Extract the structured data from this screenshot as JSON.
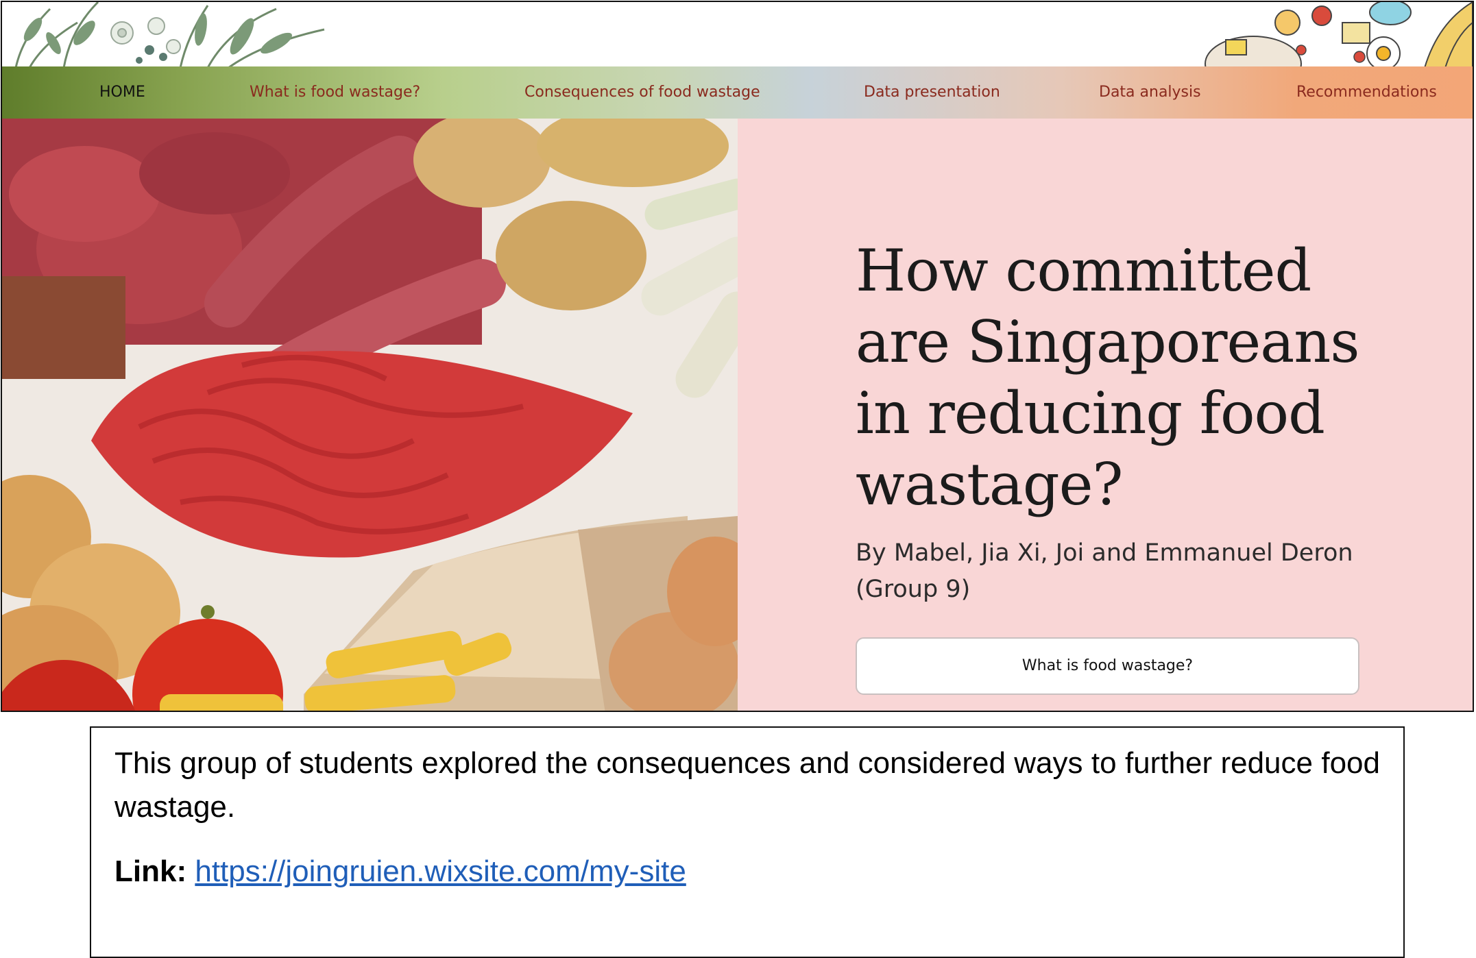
{
  "nav": {
    "items": [
      {
        "label": "HOME",
        "active": true
      },
      {
        "label": "What is food wastage?",
        "active": false
      },
      {
        "label": "Consequences of food wastage",
        "active": false
      },
      {
        "label": "Data presentation",
        "active": false
      },
      {
        "label": "Data analysis",
        "active": false
      },
      {
        "label": "Recommendations",
        "active": false
      }
    ]
  },
  "hero": {
    "title": "How committed are Singaporeans in reducing food wastage?",
    "authors": "By Mabel, Jia Xi, Joi and Emmanuel Deron  (Group 9)",
    "button_label": "What is food wastage?",
    "panel_color": "#f9d6d6"
  },
  "caption": {
    "text": "This group of students explored the consequences and considered ways to further reduce food wastage.",
    "link_label": "Link:",
    "link_url": "https://joingruien.wixsite.com/my-site"
  },
  "colors": {
    "nav_link": "#8a2a1e",
    "nav_active": "#111111",
    "link_blue": "#1f5eb8"
  }
}
